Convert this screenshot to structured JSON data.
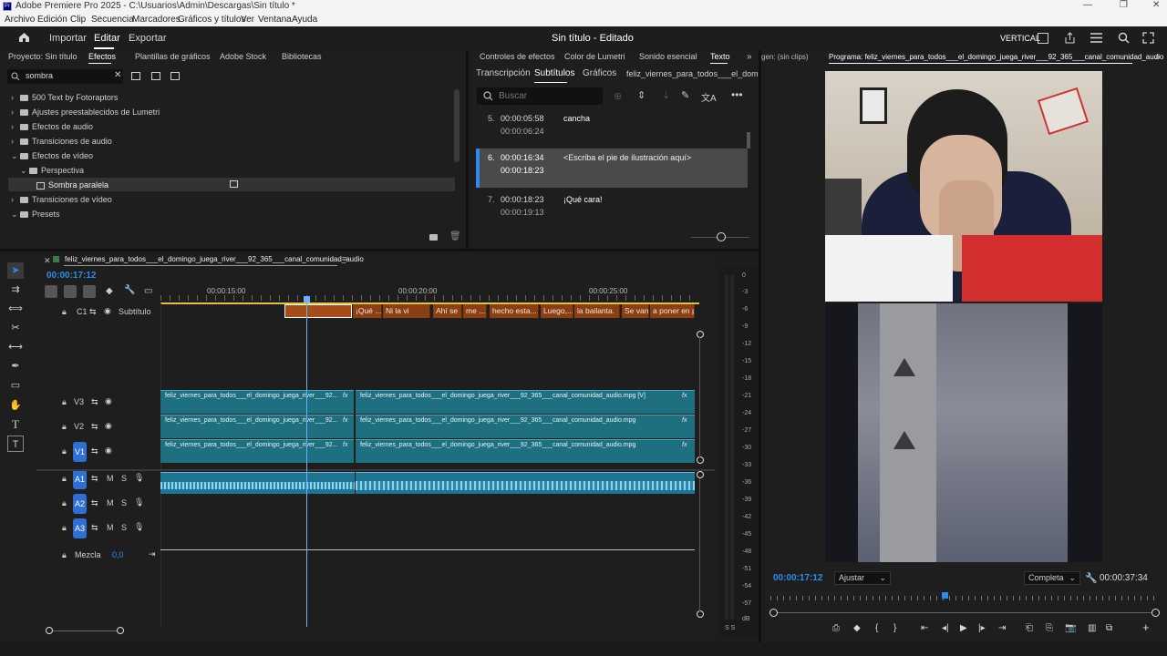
{
  "app": {
    "title": "Adobe Premiere Pro 2025 - C:\\Usuarios\\Admin\\Descargas\\Sin título *",
    "logo_text": "Pr",
    "menu": [
      "Archivo",
      "Edición",
      "Clip",
      "Secuencia",
      "Marcadores",
      "Gráficos y títulos",
      "Ver",
      "Ventana",
      "Ayuda"
    ]
  },
  "header": {
    "nav": [
      "Importar",
      "Editar",
      "Exportar"
    ],
    "active_nav": "Editar",
    "project_title": "Sin título - Editado",
    "vertical_label": "VERTICAL"
  },
  "effects_panel": {
    "tabs": [
      "Proyecto: Sin título",
      "Efectos",
      "Plantillas de gráficos",
      "Adobe Stock",
      "Bibliotecas"
    ],
    "active_tab": "Efectos",
    "search_value": "sombra",
    "tree": [
      {
        "label": "500 Text by Fotoraptors",
        "arrow": "›"
      },
      {
        "label": "Ajustes preestablecidos de Lumetri",
        "arrow": "›"
      },
      {
        "label": "Efectos de audio",
        "arrow": "›"
      },
      {
        "label": "Transiciones de audio",
        "arrow": "›"
      },
      {
        "label": "Efectos de vídeo",
        "arrow": "⌄"
      },
      {
        "label": "Perspectiva",
        "arrow": "⌄"
      },
      {
        "label": "Sombra paralela",
        "arrow": ""
      },
      {
        "label": "Transiciones de vídeo",
        "arrow": "›"
      },
      {
        "label": "Presets",
        "arrow": "⌄"
      }
    ]
  },
  "text_panel": {
    "tabs": [
      "Controles de efectos",
      "Color de Lumetri",
      "Sonido esencial",
      "Texto"
    ],
    "active_tab": "Texto",
    "subtabs": [
      "Transcripción",
      "Subtítulos",
      "Gráficos",
      "feliz_viernes_para_todos___el_domi"
    ],
    "active_subtab": "Subtítulos",
    "search_placeholder": "Buscar",
    "captions": [
      {
        "num": "5.",
        "in": "00:00:05:58",
        "out": "00:00:06:24",
        "text": "cancha"
      },
      {
        "num": "6.",
        "in": "00:00:16:34",
        "out": "00:00:18:23",
        "text": "<Escriba el pie de ilustración aquí>"
      },
      {
        "num": "7.",
        "in": "00:00:18:23",
        "out": "00:00:19:13",
        "text": "¡Qué cara!"
      }
    ]
  },
  "program_monitor": {
    "source_tab": "gen: (sin clips)",
    "program_tab": "Programa: feliz_viernes_para_todos___el_domingo_juega_river___92_365___canal_comunidad_audio",
    "current_time": "00:00:17:12",
    "fit_value": "Ajustar",
    "quality_value": "Completa",
    "duration": "00:00:37:34"
  },
  "timeline": {
    "sequence_name": "feliz_viernes_para_todos___el_domingo_juega_river___92_365___canal_comunidad_audio",
    "timecode": "00:00:17:12",
    "ruler": [
      "00:00:15:00",
      "00:00:20:00",
      "00:00:25:00"
    ],
    "caption_track_label": "Subtítulo",
    "caption_track_id": "C1",
    "subtitle_clips": [
      "¡Qué ...",
      "Ni la vi",
      "Ahí se",
      "me ...",
      "hecho esta...",
      "Luego,...",
      "la bailanta.",
      "Se van",
      "a poner en p"
    ],
    "video_tracks": [
      {
        "id": "V3",
        "clip_a": "feliz_viernes_para_todos___el_domingo_juega_river___92...",
        "clip_b": "feliz_viernes_para_todos___el_domingo_juega_river___92_365___canal_comunidad_audio.mpg [V]"
      },
      {
        "id": "V2",
        "clip_a": "feliz_viernes_para_todos___el_domingo_juega_river___92...",
        "clip_b": "feliz_viernes_para_todos___el_domingo_juega_river___92_365___canal_comunidad_audio.mpg"
      },
      {
        "id": "V1",
        "clip_a": "feliz_viernes_para_todos___el_domingo_juega_river___92...",
        "clip_b": "feliz_viernes_para_todos___el_domingo_juega_river___92_365___canal_comunidad_audio.mpg"
      }
    ],
    "audio_tracks": [
      "A1",
      "A2",
      "A3"
    ],
    "mix_label": "Mezcla",
    "mix_value": "0,0",
    "fx_label": "fx"
  },
  "meter": {
    "labels": [
      "0",
      "-3",
      "-6",
      "-9",
      "-12",
      "-15",
      "-18",
      "-21",
      "-24",
      "-27",
      "-30",
      "-33",
      "-36",
      "-39",
      "-42",
      "-45",
      "-48",
      "-51",
      "-54",
      "-57",
      "dB"
    ],
    "solo_label": "S S"
  },
  "colors": {
    "accent": "#2d8ceb",
    "video_clip": "#1e6f80",
    "subtitle_clip": "#8a3f12",
    "audio_clip": "#1f7491",
    "playhead": "#6ab0ff"
  }
}
